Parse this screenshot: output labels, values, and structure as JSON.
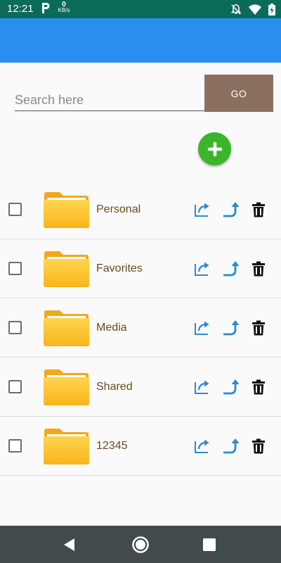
{
  "status_bar": {
    "time": "12:21",
    "network_speed_value": "0",
    "network_speed_unit": "KB/s"
  },
  "search": {
    "placeholder": "Search here",
    "value": "",
    "go_label": "GO"
  },
  "colors": {
    "status_bar": "#0b6b59",
    "app_bar": "#2a8ef0",
    "go_button": "#8b7060",
    "add_button": "#3bb62a",
    "folder_name": "#6b4a1e",
    "action_icon": "#2a8ad6",
    "nav_bar": "#414a4c"
  },
  "folders": [
    {
      "name": "Personal",
      "checked": false
    },
    {
      "name": "Favorites",
      "checked": false
    },
    {
      "name": "Media",
      "checked": false
    },
    {
      "name": "Shared",
      "checked": false
    },
    {
      "name": "12345",
      "checked": false
    }
  ],
  "icons": {
    "add": "plus-circle-icon",
    "folder": "folder-icon",
    "share": "share-icon",
    "forward": "forward-arrow-icon",
    "delete": "trash-icon",
    "nav_back": "back-triangle-icon",
    "nav_home": "home-circle-icon",
    "nav_recent": "recents-square-icon"
  }
}
